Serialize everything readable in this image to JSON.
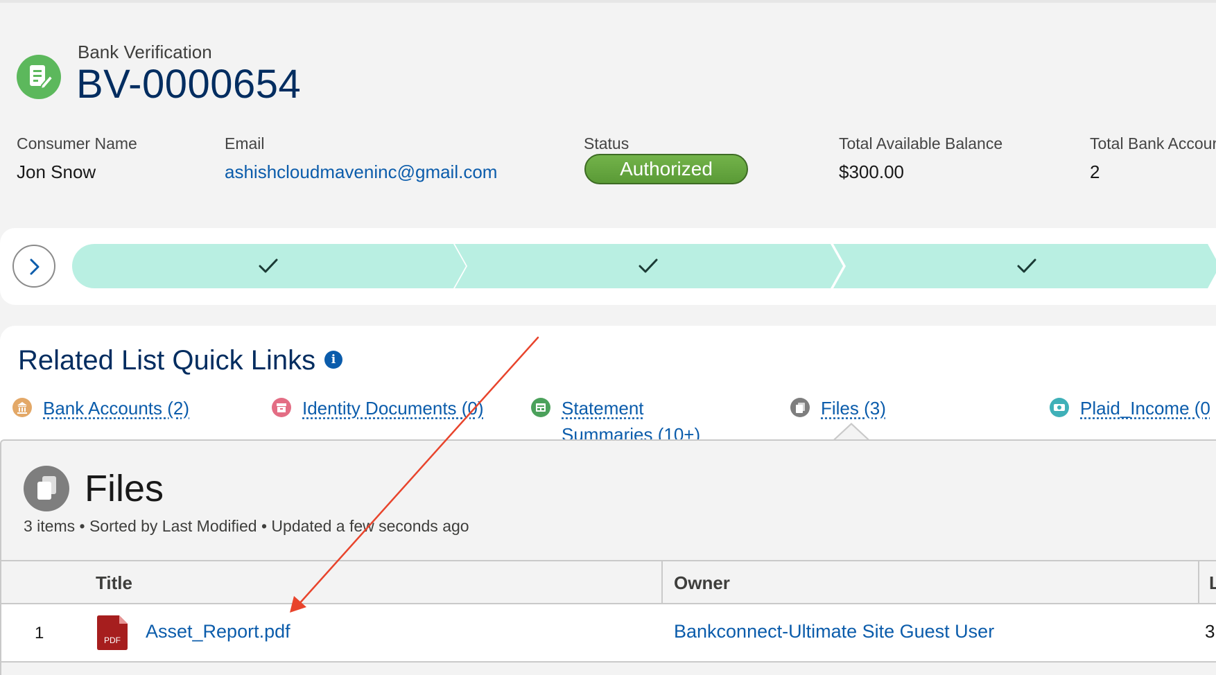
{
  "header": {
    "object_label": "Bank Verification",
    "record_name": "BV-0000654",
    "record_icon": "contract-icon"
  },
  "highlights": {
    "consumer_name": {
      "label": "Consumer Name",
      "value": "Jon Snow"
    },
    "email": {
      "label": "Email",
      "value": "ashishcloudmaveninc@gmail.com"
    },
    "status": {
      "label": "Status",
      "value": "Authorized",
      "color": "#6aa842"
    },
    "total_available_balance": {
      "label": "Total Available Balance",
      "value": "$300.00"
    },
    "total_bank_accounts": {
      "label": "Total Bank Accour",
      "value": "2"
    }
  },
  "path": {
    "toggle_icon": "chevron-right-icon",
    "completed_color": "#b9efe2",
    "stages": [
      {
        "state": "complete",
        "icon": "check-icon"
      },
      {
        "state": "complete",
        "icon": "check-icon"
      },
      {
        "state": "complete",
        "icon": "check-icon"
      }
    ]
  },
  "related_quick_links": {
    "title": "Related List Quick Links",
    "links": [
      {
        "label": "Bank Accounts (2)",
        "icon": "bank-icon",
        "color": "#e3a867"
      },
      {
        "label": "Identity Documents (0)",
        "icon": "archive-icon",
        "color": "#e36d84"
      },
      {
        "label_line1": "Statement",
        "label_line2": "Summaries (10+)",
        "icon": "form-icon",
        "color": "#4ba15b"
      },
      {
        "label": "Files (3)",
        "icon": "file-icon",
        "color": "#7e7e7e"
      },
      {
        "label": "Plaid_Income (0",
        "icon": "money-icon",
        "color": "#3fb0b8"
      }
    ]
  },
  "files": {
    "title": "Files",
    "meta": "3 items • Sorted by Last Modified • Updated a few seconds ago",
    "columns": [
      "Title",
      "Owner"
    ],
    "edge_column": "L",
    "rows": [
      {
        "num": "1",
        "title": "Asset_Report.pdf",
        "owner": "Bankconnect-Ultimate Site Guest User",
        "edge": "3",
        "file_type": "PDF",
        "file_color": "#a61e1e"
      }
    ]
  },
  "annotation": {
    "color": "#e8442c"
  }
}
